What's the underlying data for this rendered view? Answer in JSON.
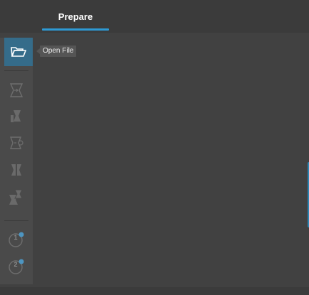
{
  "tabs": [
    {
      "label": "Prepare",
      "active": true
    }
  ],
  "tooltip": {
    "text": "Open File"
  },
  "toolbar": {
    "tools": [
      {
        "name": "open-file",
        "icon": "folder-open-icon",
        "active": true
      },
      {
        "name": "move",
        "icon": "move-icon",
        "active": false
      },
      {
        "name": "scale",
        "icon": "scale-icon",
        "active": false
      },
      {
        "name": "rotate",
        "icon": "rotate-icon",
        "active": false
      },
      {
        "name": "mirror",
        "icon": "mirror-icon",
        "active": false
      },
      {
        "name": "per-model-settings",
        "icon": "per-model-settings-icon",
        "active": false
      },
      {
        "name": "extruder-1",
        "icon": "extruder-1-icon",
        "label": "1",
        "active": false
      },
      {
        "name": "extruder-2",
        "icon": "extruder-2-icon",
        "label": "2",
        "active": false
      }
    ]
  },
  "colors": {
    "background": "#414141",
    "accent": "#2e9ad4",
    "active_tool": "#356c8a"
  }
}
